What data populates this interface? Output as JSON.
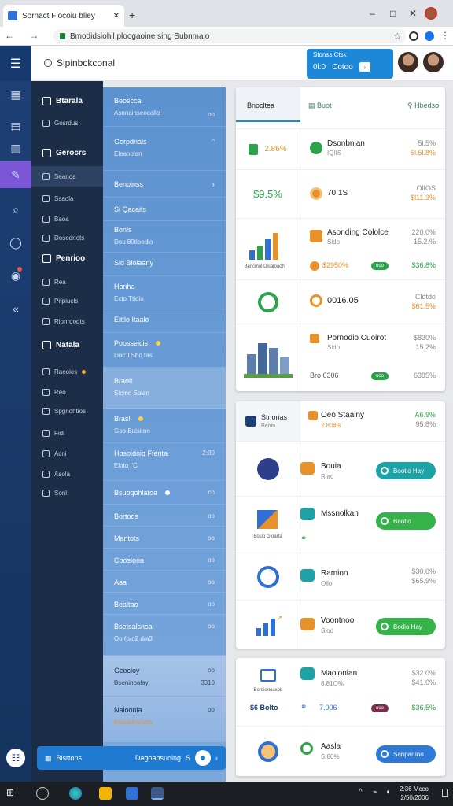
{
  "browser": {
    "tab_title": "Sornact Fiocoiu bliey",
    "new_tab_symbol": "+",
    "window_controls": [
      "–",
      "□",
      "✕"
    ],
    "nav_symbols": "← → C",
    "url": "Bmodidsiohil ploogaoine sing Subnmalo",
    "star": "☆",
    "menu": "⋮"
  },
  "header": {
    "menu_icon": "☰",
    "title": "Sipinbckconal",
    "widget": {
      "label": "Stonss Ctsk",
      "value": "0l:0",
      "status": "Cotoo",
      "arrow": "›"
    }
  },
  "rail": {
    "icons": [
      "chart-icon",
      "grid-icon",
      "edit-icon",
      "search-icon",
      "chat-icon",
      "badge-icon",
      "collapse-icon"
    ],
    "bottom_icon": "☷"
  },
  "nav": [
    {
      "label": "Btarala",
      "type": "hdr"
    },
    {
      "label": "Gosrdus",
      "type": "item"
    },
    {
      "label": "Gerocrs",
      "type": "hdr"
    },
    {
      "label": "Seanoa",
      "type": "item"
    },
    {
      "label": "Ssaola",
      "type": "item"
    },
    {
      "label": "Baoa",
      "type": "item"
    },
    {
      "label": "Dosodnots",
      "type": "item"
    },
    {
      "label": "Penrioo",
      "type": "hdr"
    },
    {
      "label": "Rea",
      "type": "item"
    },
    {
      "label": "Pripiucls",
      "type": "item"
    },
    {
      "label": "Rionrdoots",
      "type": "item"
    },
    {
      "label": "Natala",
      "type": "hdr"
    },
    {
      "label": "Raeoies",
      "type": "item",
      "dot": true
    },
    {
      "label": "Reo",
      "type": "item"
    },
    {
      "label": "Spgnohtios",
      "type": "item"
    },
    {
      "label": "Fidi",
      "type": "item"
    },
    {
      "label": "Acni",
      "type": "item"
    },
    {
      "label": "Asola",
      "type": "item"
    },
    {
      "label": "Sonl",
      "type": "item"
    }
  ],
  "list": [
    {
      "title": "Beoscca",
      "sub": "Asnnainseocalio",
      "right": "oo"
    },
    {
      "title": "Gorpdnals",
      "sub": "Eleanolan",
      "right": "^"
    },
    {
      "title": "Benoinss",
      "sub": "",
      "right": "›"
    },
    {
      "title": "Si Qacaits",
      "sub": "",
      "right": ""
    },
    {
      "title": "Bonls",
      "sub": "Dou 80tloodio",
      "right": ""
    },
    {
      "title": "Sio Bloiaany",
      "sub": "",
      "right": ""
    },
    {
      "title": "Hanha",
      "sub": "Ecto Ttidio",
      "right": ""
    },
    {
      "title": "Eittlo Itaalo",
      "sub": "",
      "right": ""
    },
    {
      "title": "Poosseicis",
      "sub": "Doc'll Sho tas",
      "right": "",
      "dot": true
    },
    {
      "title": "Braoit",
      "sub": "Sicmo Sblan",
      "right": ""
    },
    {
      "title": "Brasl",
      "sub": "Goo Buisiton",
      "right": "",
      "dot": true
    },
    {
      "title": "Hosoidnig Ffenta",
      "sub": "Eioto I'C",
      "right": "2:30"
    },
    {
      "title": "Bsuoqohlatoa",
      "sub": "",
      "right": "co",
      "dot": true
    },
    {
      "title": "Bortoos",
      "sub": "",
      "right": "oo"
    },
    {
      "title": "Mantots",
      "sub": "",
      "right": "oo"
    },
    {
      "title": "Cooslona",
      "sub": "",
      "right": "oo"
    },
    {
      "title": "Aaa",
      "sub": "",
      "right": "oo"
    },
    {
      "title": "Bealtao",
      "sub": "",
      "right": "oo"
    },
    {
      "title": "Bsetsalsnsa",
      "sub": "Oo (o/o2 d/a3",
      "right": "oo"
    }
  ],
  "list_bottom": [
    {
      "title": "Gcocloy",
      "sub": "Bseninoalay",
      "right": "oo",
      "right2": "3310"
    },
    {
      "title": "Naloonla",
      "sub": "Bosaldosnota",
      "right": "oo"
    }
  ],
  "footer": {
    "label": "Bisrtons",
    "status": "Dagoabsuoing",
    "s": "S",
    "arrow": "›"
  },
  "card1": {
    "tabs": [
      {
        "label": "Bnocltea"
      },
      {
        "label": "Buot"
      },
      {
        "label": "Hbedso"
      }
    ],
    "rows": [
      {
        "left_value": "2.86%",
        "title": "Dsonbnlan",
        "sub": "IQIIS",
        "r1": "5l.5%",
        "r2": "5l.5l.8%"
      },
      {
        "left_value": "$9.5%",
        "title": "70.1S",
        "sub": "",
        "r1": "OlIOS",
        "r2": "$l11.3%"
      },
      {
        "chart": "Bencinol Disaloaoh",
        "title": "Asonding Cololce",
        "sub": "Sido",
        "r1": "220.0%",
        "r2": "15.2.%",
        "bottom_value": "$2950%",
        "tag": "ooo",
        "r3": "$36.8%"
      },
      {
        "title": "0016.05",
        "r1": "Clotdo",
        "r2": "$61.5%"
      },
      {
        "title": "Pornodio Cuoirot",
        "sub": "Sido",
        "r1": "$830%",
        "r2": "15.2%",
        "bottom_value": "Bro 0306",
        "tag": "ooo",
        "r3": "6385%"
      }
    ]
  },
  "card2": {
    "rows": [
      {
        "title": "Stnorias",
        "sub": "Bento",
        "name": "Oeo Staainy",
        "name_sub": "2.8:dlls",
        "r1": "A6.9%",
        "r2": "95.8%"
      },
      {
        "name": "Bouia",
        "name_sub": "Riao",
        "button": "Bootlo Hay"
      },
      {
        "title": "Bosio Gloarta",
        "name": "Mssnolkan",
        "button": "Baotio"
      },
      {
        "name": "Ramion",
        "name_sub": "Ollo",
        "r1": "$30.0%",
        "r2": "$65.9%"
      },
      {
        "name": "Voontnoo",
        "name_sub": "Slod",
        "button": "Bodio Hay"
      }
    ]
  },
  "card3": {
    "rows": [
      {
        "title": "Borsiorioaxob",
        "name": "Maolonlan",
        "name_sub": "8.81O%",
        "r1": "$32.0%",
        "r2": "$41.0%",
        "bottom_left": "$6 Bolto",
        "bottom_mid": "7.006",
        "tag": "ooo",
        "r3": "$36.5%"
      },
      {
        "name": "Aasla",
        "name_sub": "S.80%",
        "button": "Sanpar ino"
      }
    ]
  },
  "taskbar": {
    "time": "2:36 Mcco",
    "date": "2/50/2006"
  },
  "colors": {
    "rail": "#1d3f74",
    "nav": "#1c2d48",
    "list": "#6a9dd6",
    "accent_green": "#2ca34a",
    "accent_orange": "#e7912a",
    "teal": "#1fa2a6",
    "purple": "#7b57d8"
  }
}
